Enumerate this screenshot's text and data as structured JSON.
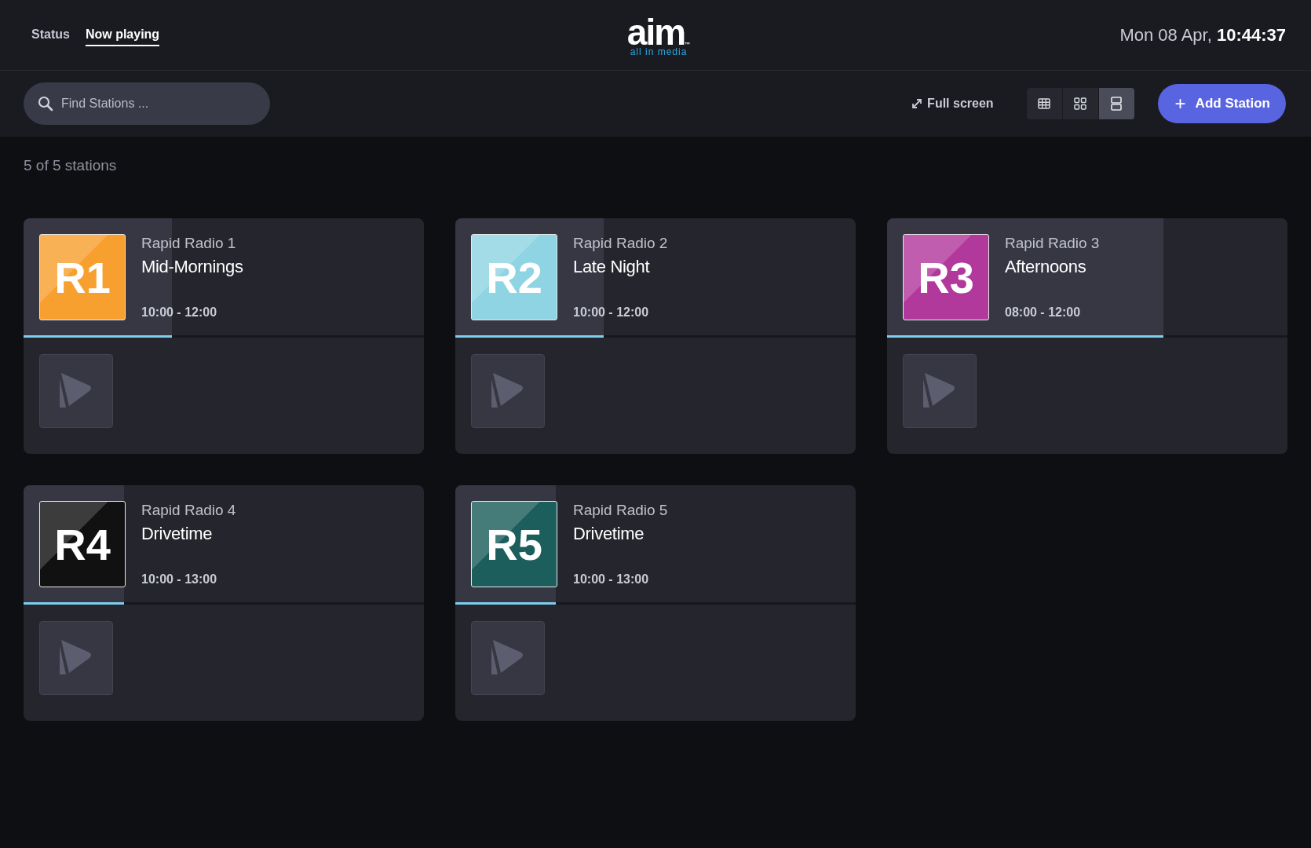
{
  "nav": {
    "tabs": [
      {
        "label": "Status",
        "selected": false
      },
      {
        "label": "Now playing",
        "selected": true
      }
    ]
  },
  "logo": {
    "wordmark": "aim",
    "trademark": "™",
    "tagline": "all in media"
  },
  "clock": {
    "date": "Mon 08 Apr,",
    "time": "10:44:37"
  },
  "search": {
    "placeholder": "Find Stations ..."
  },
  "fullscreen": {
    "label": "Full screen"
  },
  "view_modes": [
    {
      "kind": "table",
      "selected": false
    },
    {
      "kind": "grid",
      "selected": false
    },
    {
      "kind": "rows",
      "selected": true
    }
  ],
  "add_button": {
    "icon": "+",
    "label": "Add Station"
  },
  "count": "5 of 5 stations",
  "stations": [
    {
      "badge": "R1",
      "color": "#f7a02f",
      "name": "Rapid Radio 1",
      "show": "Mid-Mornings",
      "time": "10:00 - 12:00",
      "level": 0.37
    },
    {
      "badge": "R2",
      "color": "#8fd4e2",
      "name": "Rapid Radio 2",
      "show": "Late Night",
      "time": "10:00 - 12:00",
      "level": 0.37
    },
    {
      "badge": "R3",
      "color": "#b2399c",
      "name": "Rapid Radio 3",
      "show": "Afternoons",
      "time": "08:00 - 12:00",
      "level": 0.69
    },
    {
      "badge": "R4",
      "color": "#111111",
      "name": "Rapid Radio 4",
      "show": "Drivetime",
      "time": "10:00 - 13:00",
      "level": 0.25
    },
    {
      "badge": "R5",
      "color": "#1c5e5b",
      "name": "Rapid Radio 5",
      "show": "Drivetime",
      "time": "10:00 - 13:00",
      "level": 0.25
    }
  ]
}
